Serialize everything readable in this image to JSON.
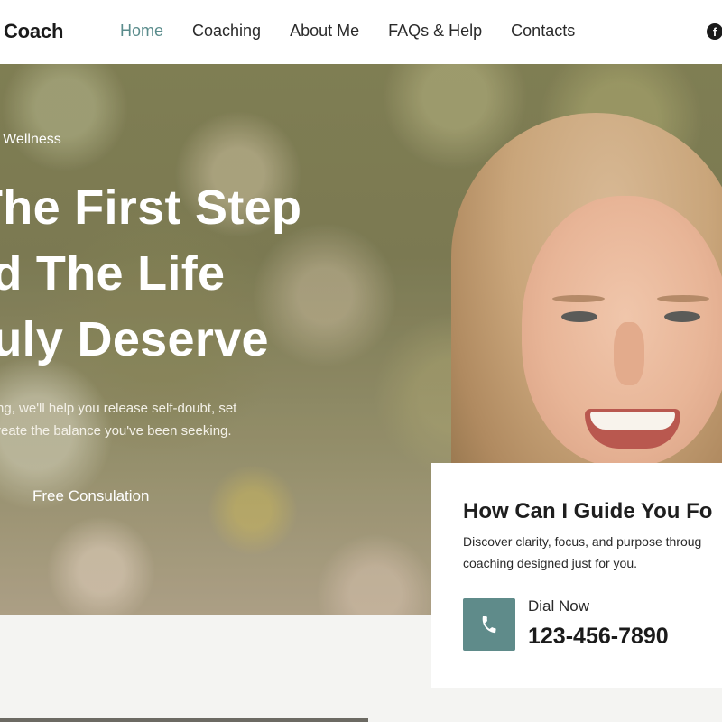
{
  "header": {
    "brand": "e Coach",
    "nav": [
      {
        "label": "Home",
        "active": true
      },
      {
        "label": "Coaching",
        "active": false
      },
      {
        "label": "About Me",
        "active": false
      },
      {
        "label": "FAQs & Help",
        "active": false
      },
      {
        "label": "Contacts",
        "active": false
      }
    ],
    "social_icon": "facebook-icon",
    "accent_color": "#5a8c8c"
  },
  "hero": {
    "eyebrow": "& Wellness",
    "headline": [
      "The First Step",
      "rd The Life",
      "ruly Deserve"
    ],
    "subtext": [
      "ng, we'll help you release self-doubt, set",
      "reate the balance you've been seeking."
    ],
    "cta_label": "Free Consulation"
  },
  "card": {
    "title": "How Can I Guide You Fo",
    "text": [
      "Discover clarity, focus, and purpose throug",
      "coaching designed just for you."
    ],
    "dial_label": "Dial Now",
    "phone_number": "123-456-7890",
    "phone_icon": "phone-icon",
    "button_color": "#5f8b8a"
  }
}
